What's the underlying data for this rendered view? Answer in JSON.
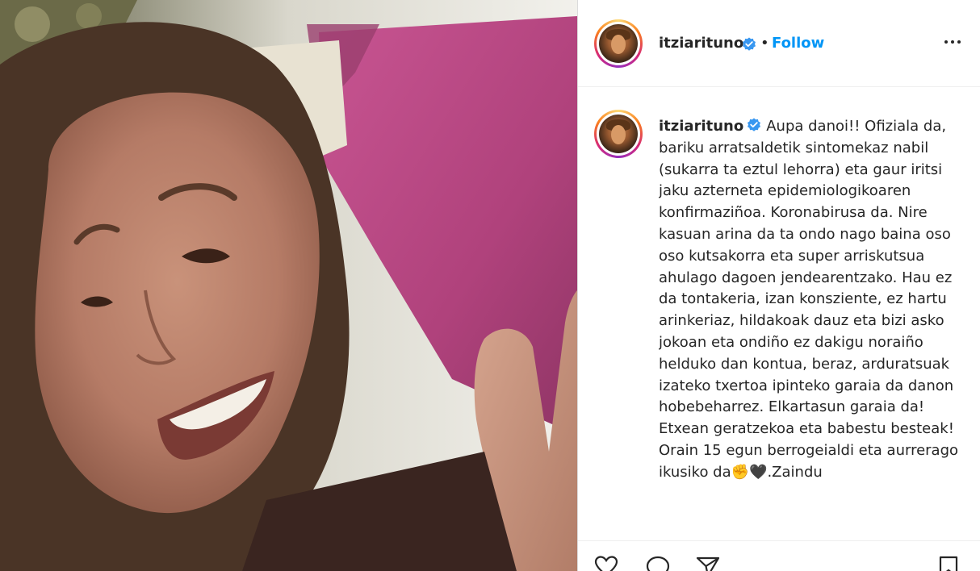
{
  "header": {
    "username": "itziarituno",
    "separator": "•",
    "follow_label": "Follow",
    "verified_icon": "verified-badge-icon",
    "more_icon": "more-options-icon"
  },
  "caption": {
    "username": "itziarituno",
    "text": "Aupa danoi!! Ofiziala da, bariku arratsaldetik sintomekaz nabil (sukarra ta eztul lehorra) eta gaur iritsi jaku azterneta epidemiologikoaren konfirmaziñoa. Koronabirusa da. Nire kasuan arina da ta ondo nago baina oso oso kutsakorra eta super arriskutsua ahulago dagoen jendearentzako. Hau ez da tontakeria, izan konsziente, ez hartu arinkeriaz, hildakoak dauz eta bizi asko jokoan eta ondiño ez dakigu noraiño helduko dan kontua, beraz, arduratsuak izateko txertoa ipinteko garaia da danon hobebeharrez. Elkartasun garaia da! Etxean geratzekoa eta babestu besteak!\nOrain 15 egun berrogeialdi eta aurrerago ikusiko da✊🖤.Zaindu"
  },
  "actions": {
    "like_icon": "heart-icon",
    "comment_icon": "comment-icon",
    "share_icon": "share-icon",
    "save_icon": "bookmark-icon"
  },
  "colors": {
    "link_blue": "#0095f6",
    "verified_blue": "#3897f0",
    "text": "#262626",
    "pillow_magenta": "#b8437f"
  }
}
